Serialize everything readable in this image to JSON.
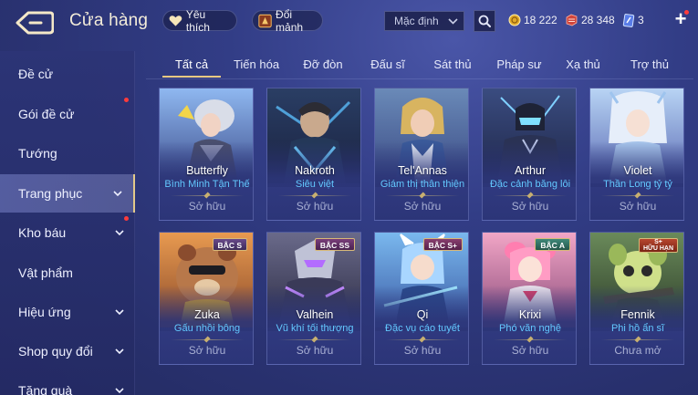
{
  "header": {
    "title": "Cửa hàng",
    "favorites_label": "Yêu thích",
    "exchange_label": "Đổi mảnh",
    "sort": {
      "selected": "Mặc định"
    },
    "currencies": {
      "gold": "18 222",
      "gems": "28 348",
      "tickets": "3"
    },
    "plus": "+"
  },
  "sidebar": {
    "items": [
      {
        "label": "Đề cử"
      },
      {
        "label": "Gói đề cử"
      },
      {
        "label": "Tướng"
      },
      {
        "label": "Trang phục"
      },
      {
        "label": "Kho báu"
      },
      {
        "label": "Vật phẩm"
      },
      {
        "label": "Hiệu ứng"
      },
      {
        "label": "Shop quy đổi"
      },
      {
        "label": "Tặng quà"
      }
    ]
  },
  "tabs": [
    "Tất cả",
    "Tiến hóa",
    "Đỡ đòn",
    "Đấu sĩ",
    "Sát thủ",
    "Pháp sư",
    "Xạ thủ",
    "Trợ thủ"
  ],
  "cards": [
    {
      "hero": "Butterfly",
      "skin": "Bình Minh Tận Thế",
      "status": "Sở hữu",
      "badge": ""
    },
    {
      "hero": "Nakroth",
      "skin": "Siêu việt",
      "status": "Sở hữu",
      "badge": ""
    },
    {
      "hero": "Tel'Annas",
      "skin": "Giám thị thân thiện",
      "status": "Sở hữu",
      "badge": ""
    },
    {
      "hero": "Arthur",
      "skin": "Đặc cảnh băng lôi",
      "status": "Sở hữu",
      "badge": ""
    },
    {
      "hero": "Violet",
      "skin": "Thần Long tỷ tỷ",
      "status": "Sở hữu",
      "badge": ""
    },
    {
      "hero": "Zuka",
      "skin": "Gấu nhồi bông",
      "status": "Sở hữu",
      "badge": "BẬC S"
    },
    {
      "hero": "Valhein",
      "skin": "Vũ khí tối thượng",
      "status": "Sở hữu",
      "badge": "BẬC SS"
    },
    {
      "hero": "Qi",
      "skin": "Đặc vụ cáo tuyết",
      "status": "Sở hữu",
      "badge": "BẬC S+"
    },
    {
      "hero": "Krixi",
      "skin": "Phó văn nghệ",
      "status": "Sở hữu",
      "badge": "BẬC A"
    },
    {
      "hero": "Fennik",
      "skin": "Phi hồ ẩn sĩ",
      "status": "Chưa mở",
      "badge": "S+",
      "badge_sub": "HỮU HẠN"
    }
  ],
  "colors": {
    "accent_gold": "#e8c982",
    "skin_blue": "#63c8ff",
    "notification_red": "#ff3b3b"
  },
  "icons": {
    "back": "back-arrow-icon",
    "favorite": "heart-icon",
    "exchange": "shard-chest-icon",
    "search": "search-icon",
    "gold": "gold-coin-icon",
    "gems": "voucher-gem-icon",
    "tickets": "ticket-icon"
  }
}
